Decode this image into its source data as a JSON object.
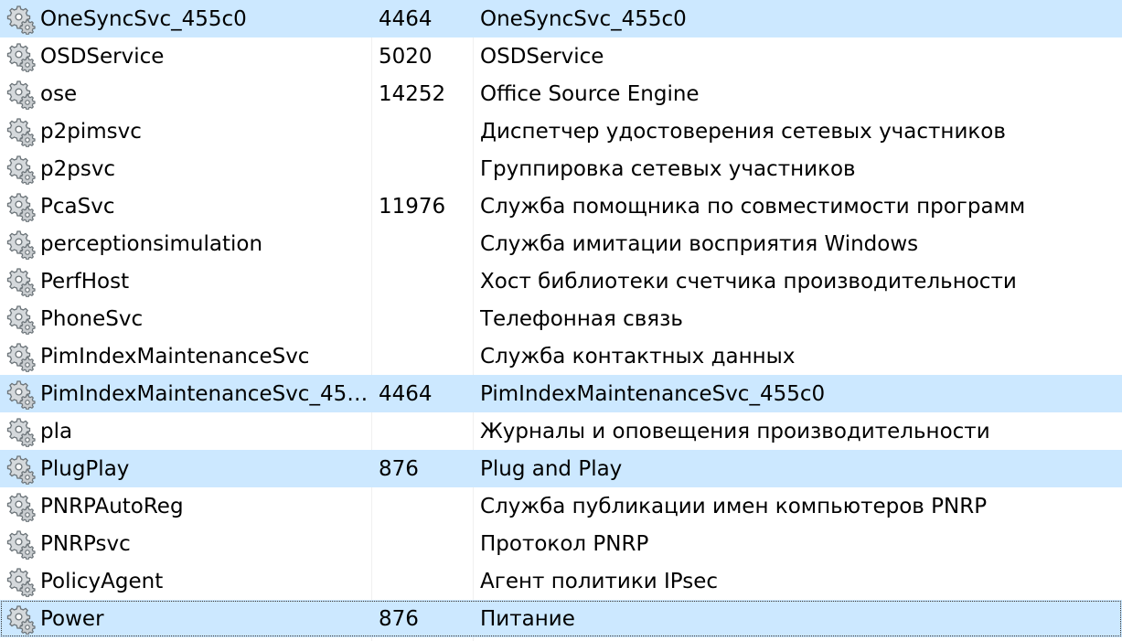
{
  "rows": [
    {
      "name": "OneSyncSvc_455c0",
      "pid": "4464",
      "description": "OneSyncSvc_455c0",
      "selected": true
    },
    {
      "name": "OSDService",
      "pid": "5020",
      "description": "OSDService",
      "selected": false
    },
    {
      "name": "ose",
      "pid": "14252",
      "description": "Office  Source Engine",
      "selected": false
    },
    {
      "name": "p2pimsvc",
      "pid": "",
      "description": "Диспетчер удостоверения сетевых участников",
      "selected": false
    },
    {
      "name": "p2psvc",
      "pid": "",
      "description": "Группировка сетевых участников",
      "selected": false
    },
    {
      "name": "PcaSvc",
      "pid": "11976",
      "description": "Служба помощника по совместимости программ",
      "selected": false
    },
    {
      "name": "perceptionsimulation",
      "pid": "",
      "description": "Служба имитации восприятия Windows",
      "selected": false
    },
    {
      "name": "PerfHost",
      "pid": "",
      "description": "Хост библиотеки счетчика производительности",
      "selected": false
    },
    {
      "name": "PhoneSvc",
      "pid": "",
      "description": "Телефонная связь",
      "selected": false
    },
    {
      "name": "PimIndexMaintenanceSvc",
      "pid": "",
      "description": "Служба контактных данных",
      "selected": false
    },
    {
      "name": "PimIndexMaintenanceSvc_45…",
      "pid": "4464",
      "description": "PimIndexMaintenanceSvc_455c0",
      "selected": true
    },
    {
      "name": "pla",
      "pid": "",
      "description": "Журналы и оповещения производительности",
      "selected": false
    },
    {
      "name": "PlugPlay",
      "pid": "876",
      "description": "Plug and Play",
      "selected": true
    },
    {
      "name": "PNRPAutoReg",
      "pid": "",
      "description": "Служба публикации имен компьютеров PNRP",
      "selected": false
    },
    {
      "name": "PNRPsvc",
      "pid": "",
      "description": "Протокол PNRP",
      "selected": false
    },
    {
      "name": "PolicyAgent",
      "pid": "",
      "description": "Агент политики IPsec",
      "selected": false
    },
    {
      "name": "Power",
      "pid": "876",
      "description": "Питание",
      "selected": true,
      "focused": true
    }
  ],
  "icon": "service-gear-icon",
  "colors": {
    "selection": "#cce8ff"
  }
}
